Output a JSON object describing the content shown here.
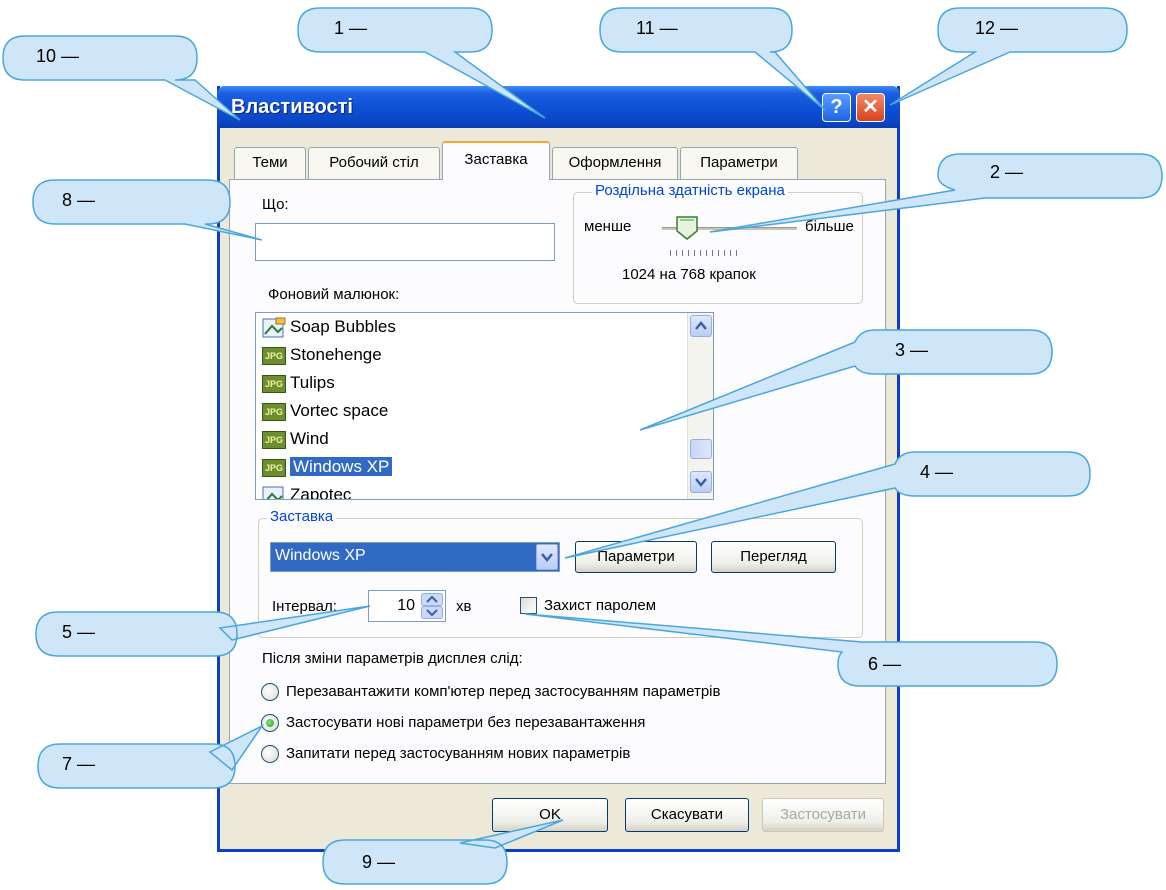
{
  "window": {
    "title": "Властивості",
    "help_label": "?",
    "close_label": "✕"
  },
  "tabs": [
    {
      "label": "Теми"
    },
    {
      "label": "Робочий стіл"
    },
    {
      "label": "Заставка"
    },
    {
      "label": "Оформлення"
    },
    {
      "label": "Параметри"
    }
  ],
  "what": {
    "label": "Що:",
    "value": ""
  },
  "resolution": {
    "group_title": "Роздільна здатність екрана",
    "less_label": "менше",
    "more_label": "більше",
    "value_text": "1024 на 768 крапок"
  },
  "wallpaper": {
    "label": "Фоновий малюнок:",
    "items": [
      {
        "name": "Soap Bubbles",
        "icon": "image-icon"
      },
      {
        "name": "Stonehenge",
        "icon": "jpg-icon"
      },
      {
        "name": "Tulips",
        "icon": "jpg-icon"
      },
      {
        "name": "Vortec space",
        "icon": "jpg-icon"
      },
      {
        "name": "Wind",
        "icon": "jpg-icon"
      },
      {
        "name": "Windows XP",
        "icon": "jpg-icon",
        "selected": true
      },
      {
        "name": "Zapotec",
        "icon": "image-icon"
      }
    ],
    "jpg_badge": "JPG"
  },
  "screensaver": {
    "group_title": "Заставка",
    "selected": "Windows XP",
    "settings_label": "Параметри",
    "preview_label": "Перегляд",
    "interval_label": "Інтервал:",
    "interval_value": "10",
    "interval_unit": "хв",
    "password_label": "Захист паролем"
  },
  "after_change": {
    "label": "Після зміни параметрів дисплея слід:",
    "options": [
      {
        "label": "Перезавантажити комп'ютер перед застосуванням параметрів",
        "checked": false
      },
      {
        "label": "Застосувати нові параметри без перезавантаження",
        "checked": true
      },
      {
        "label": "Запитати перед застосуванням нових параметрів",
        "checked": false
      }
    ]
  },
  "footer": {
    "ok_label": "OK",
    "cancel_label": "Скасувати",
    "apply_label": "Застосувати"
  },
  "callouts": [
    {
      "label": "1 —"
    },
    {
      "label": "2 —"
    },
    {
      "label": "3 —"
    },
    {
      "label": "4 —"
    },
    {
      "label": "5 —"
    },
    {
      "label": "6 —"
    },
    {
      "label": "7 —"
    },
    {
      "label": "8 —"
    },
    {
      "label": "9 —"
    },
    {
      "label": "10 —"
    },
    {
      "label": "11 —"
    },
    {
      "label": "12 —"
    }
  ],
  "colors": {
    "titlebar": "#0b46c4",
    "selection": "#316ac5",
    "callout_fill": "#cfe6f8",
    "callout_stroke": "#4aa6dc"
  }
}
